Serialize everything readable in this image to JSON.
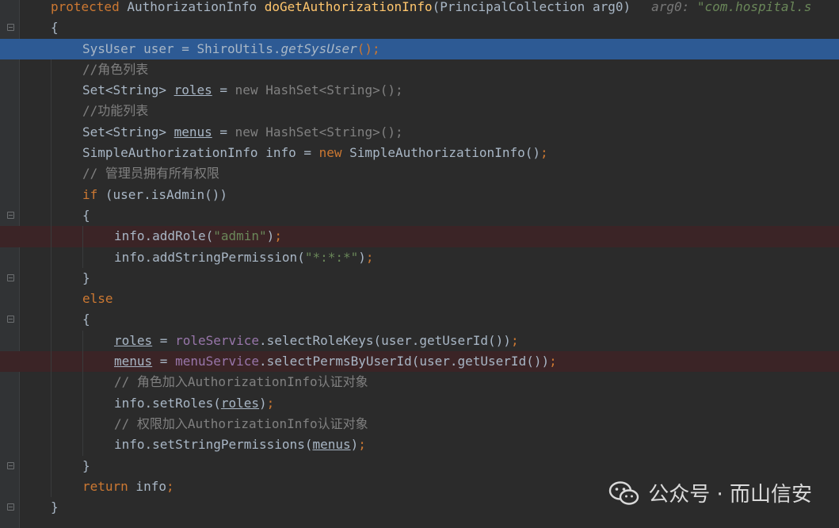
{
  "editor": {
    "signature": {
      "kw": "protected",
      "type": " AuthorizationInfo ",
      "name": "doGetAuthorizationInfo",
      "params": "(PrincipalCollection arg0)",
      "hint_label": "arg0: ",
      "hint_value": "\"com.hospital.s"
    },
    "lines": {
      "l1": "{",
      "l2a": "SysUser user = ShiroUtils.",
      "l2b": "getSysUser",
      "l2c": "();",
      "l3": "//角色列表",
      "l4a": "Set<String> ",
      "l4b": "roles",
      "l4c": " = ",
      "l4d": "new",
      "l4e": " HashSet<String>();",
      "l5": "//功能列表",
      "l6a": "Set<String> ",
      "l6b": "menus",
      "l6c": " = ",
      "l6d": "new",
      "l6e": " HashSet<String>();",
      "l7a": "SimpleAuthorizationInfo info = ",
      "l7b": "new",
      "l7c": " SimpleAuthorizationInfo()",
      "l7d": ";",
      "l8": "// 管理员拥有所有权限",
      "l9a": "if",
      "l9b": " (user.isAdmin())",
      "l10": "{",
      "l11a": "info.addRole(",
      "l11b": "\"admin\"",
      "l11c": ")",
      "l11d": ";",
      "l12a": "info.addStringPermission(",
      "l12b": "\"*:*:*\"",
      "l12c": ")",
      "l12d": ";",
      "l13": "}",
      "l14": "else",
      "l15": "{",
      "l16a": "roles",
      "l16b": " = ",
      "l16c": "roleService",
      "l16d": ".selectRoleKeys(user.getUserId())",
      "l16e": ";",
      "l17a": "menus",
      "l17b": " = ",
      "l17c": "menuService",
      "l17d": ".selectPermsByUserId(user.getUserId())",
      "l17e": ";",
      "l18": "// 角色加入AuthorizationInfo认证对象",
      "l19a": "info.setRoles(",
      "l19b": "roles",
      "l19c": ")",
      "l19d": ";",
      "l20": "// 权限加入AuthorizationInfo认证对象",
      "l21a": "info.setStringPermissions(",
      "l21b": "menus",
      "l21c": ")",
      "l21d": ";",
      "l22": "}",
      "l23a": "return",
      "l23b": " info",
      "l23c": ";",
      "l24": "}"
    }
  },
  "watermark": {
    "text": "公众号 · 而山信安",
    "icon": "wechat-icon"
  },
  "colors": {
    "background": "#2b2b2b",
    "selection": "#2d5a94",
    "breakpoint_line": "#3b2426",
    "keyword": "#cc7832",
    "method": "#ffc66d",
    "string": "#6a8759",
    "comment": "#808080",
    "field": "#9876aa"
  }
}
